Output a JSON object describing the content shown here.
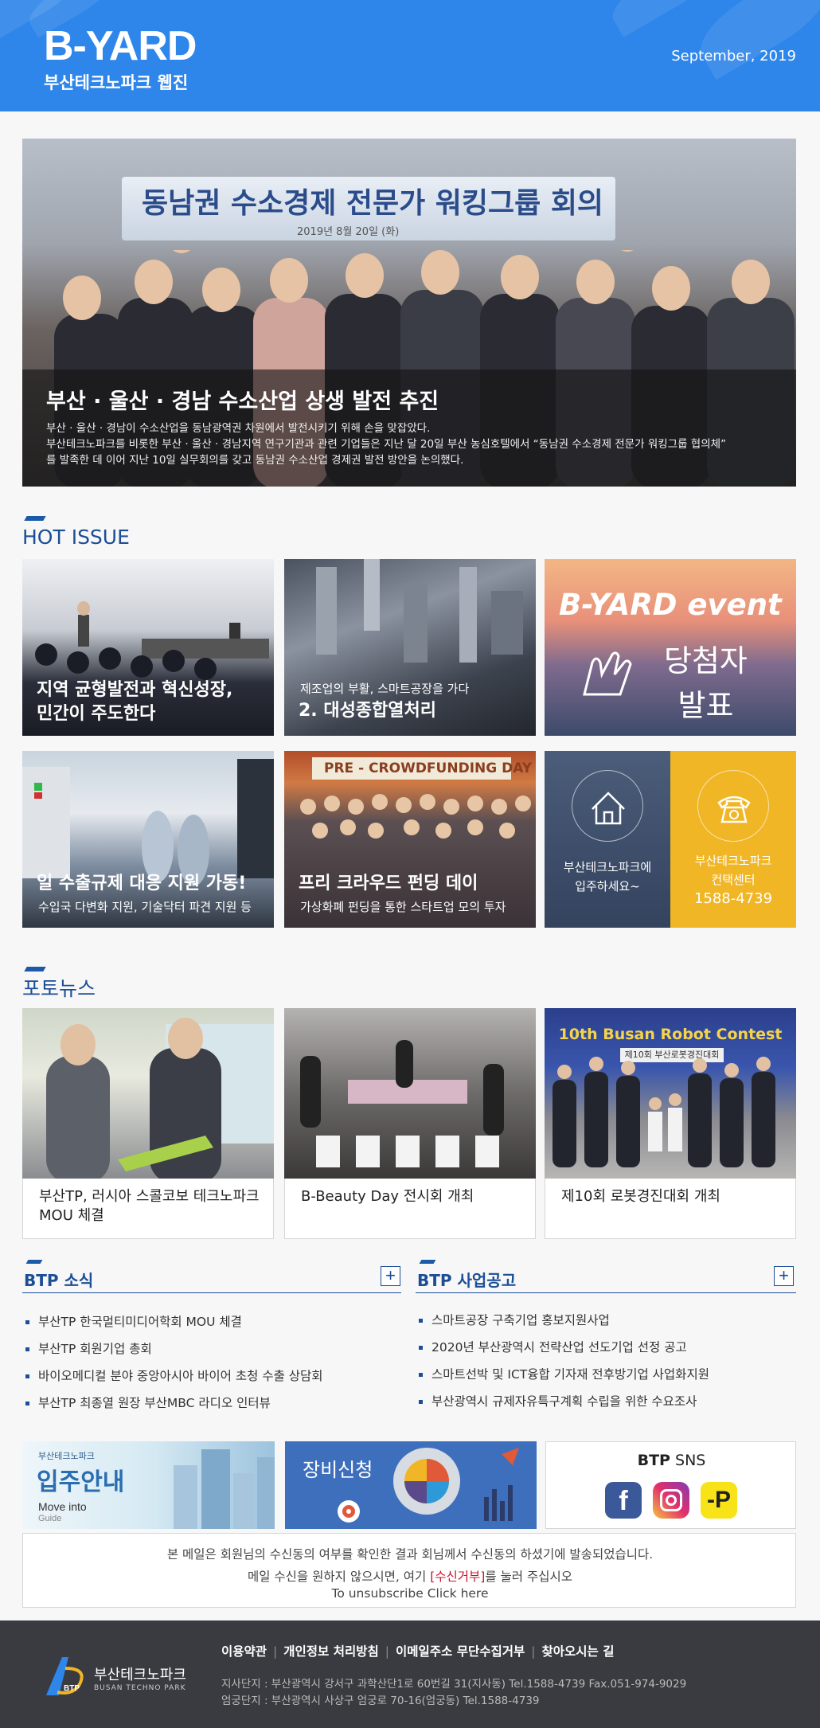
{
  "header": {
    "logo": "B-YARD",
    "subtitle": "부산테크노파크 웹진",
    "date": "September, 2019"
  },
  "hero": {
    "banner_text": "동남권 수소경제 전문가 워킹그룹 회의",
    "banner_date": "2019년 8월 20일 (화)",
    "title": "부산 · 울산 · 경남 수소산업 상생 발전 추진",
    "desc_line1": "부산 · 울산 · 경남이 수소산업을 동남광역권 차원에서 발전시키기 위해 손을 맞잡았다.",
    "desc_line2": "부산테크노파크를 비롯한 부산 · 울산 · 경남지역 연구기관과 관련 기업들은 지난 달 20일 부산 농심호텔에서 “동남권 수소경제 전문가 워킹그룹 협의체”",
    "desc_line3": "를 발족한 데 이어 지난 10일 실무회의를 갖고 동남권 수소산업 경제권 발전 방안을 논의했다."
  },
  "hot_issue": {
    "title": "HOT ISSUE",
    "tiles": [
      {
        "line1": "지역 균형발전과 혁신성장,",
        "line2": "민간이 주도한다"
      },
      {
        "sub": "제조업의 부활, 스마트공장을 가다",
        "title": "2. 대성종합열처리"
      },
      {
        "event_title": "B-YARD event",
        "event_line1": "당첨자",
        "event_line2": "발표"
      },
      {
        "title": "일 수출규제 대응 지원 가동!",
        "sub": "수입국 다변화 지원, 기술닥터 파견 지원 등"
      },
      {
        "banner": "PRE - CROWDFUNDING DAY",
        "title": "프리 크라우드 펀딩 데이",
        "sub": "가상화폐 펀딩을 통한 스타트업 모의 투자"
      },
      {
        "left_line1": "부산테크노파크에",
        "left_line2": "입주하세요~",
        "right_line1": "부산테크노파크",
        "right_line2": "컨택센터",
        "right_phone": "1588-4739"
      }
    ]
  },
  "photo_news": {
    "title": "포토뉴스",
    "items": [
      {
        "title": "부산TP, 러시아 스콜코보 테크노파크 MOU 체결"
      },
      {
        "title": "B-Beauty Day 전시회 개최"
      },
      {
        "title": "제10회 로봇경진대회 개최",
        "image_banner": "10th Busan Robot Contest",
        "image_sub": "제10회 부산로봇경진대회"
      }
    ]
  },
  "btp_news": {
    "title": "BTP 소식",
    "more": "+",
    "items": [
      "부산TP 한국멀티미디어학회 MOU 체결",
      "부산TP 회원기업 총회",
      "바이오메디컬 분야 중앙아시아 바이어 초청 수출 상담회",
      "부산TP 최종열 원장 부산MBC 라디오 인터뷰"
    ]
  },
  "btp_notice": {
    "title": "BTP 사업공고",
    "more": "+",
    "items": [
      "스마트공장 구축기업 홍보지원사업",
      "2020년 부산광역시 전략산업 선도기업 선정 공고",
      "스마트선박 및 ICT융합 기자재 전후방기업 사업화지원",
      "부산광역시 규제자유특구계획 수립을 위한 수요조사"
    ]
  },
  "banners": {
    "move_in_small": "부산테크노파크",
    "move_in_title": "입주안내",
    "move_in_en": "Move into",
    "move_in_en2": "Guide",
    "equipment": "장비신청",
    "sns_title_bold": "BTP",
    "sns_title": "SNS",
    "sns_icons": [
      "facebook-icon",
      "instagram-icon",
      "kakao-plus-icon"
    ]
  },
  "notice": {
    "line1": "본 메일은 회원님의 수신동의 여부를 확인한 결과 회님께서 수신동의 하셨기에 발송되었습니다.",
    "line2_pre": "메일 수신을 원하지 않으시면, 여기",
    "line2_link": "[수신거부]",
    "line2_post": "를 눌러 주십시오",
    "line3_pre": "To unsubscribe",
    "line3_link": "Click here"
  },
  "footer": {
    "links": [
      "이용약관",
      "개인정보 처리방침",
      "이메일주소 무단수집거부",
      "찾아오시는 길"
    ],
    "org_name": "부산테크노파크",
    "org_name_en": "BUSAN TECHNO PARK",
    "addr1": "지사단지 : 부산광역시 강서구 과학산단1로 60번길 31(지사동) Tel.1588-4739 Fax.051-974-9029",
    "addr2": "엄궁단지 : 부산광역시 사상구 엄궁로 70-16(엄궁동) Tel.1588-4739"
  },
  "colors": {
    "header_blue": "#2e86ea",
    "section_blue": "#1b4e96",
    "contact_yellow": "#f0b626",
    "footer_bg": "#3a3b40",
    "unsubscribe_red": "#c8102e"
  }
}
